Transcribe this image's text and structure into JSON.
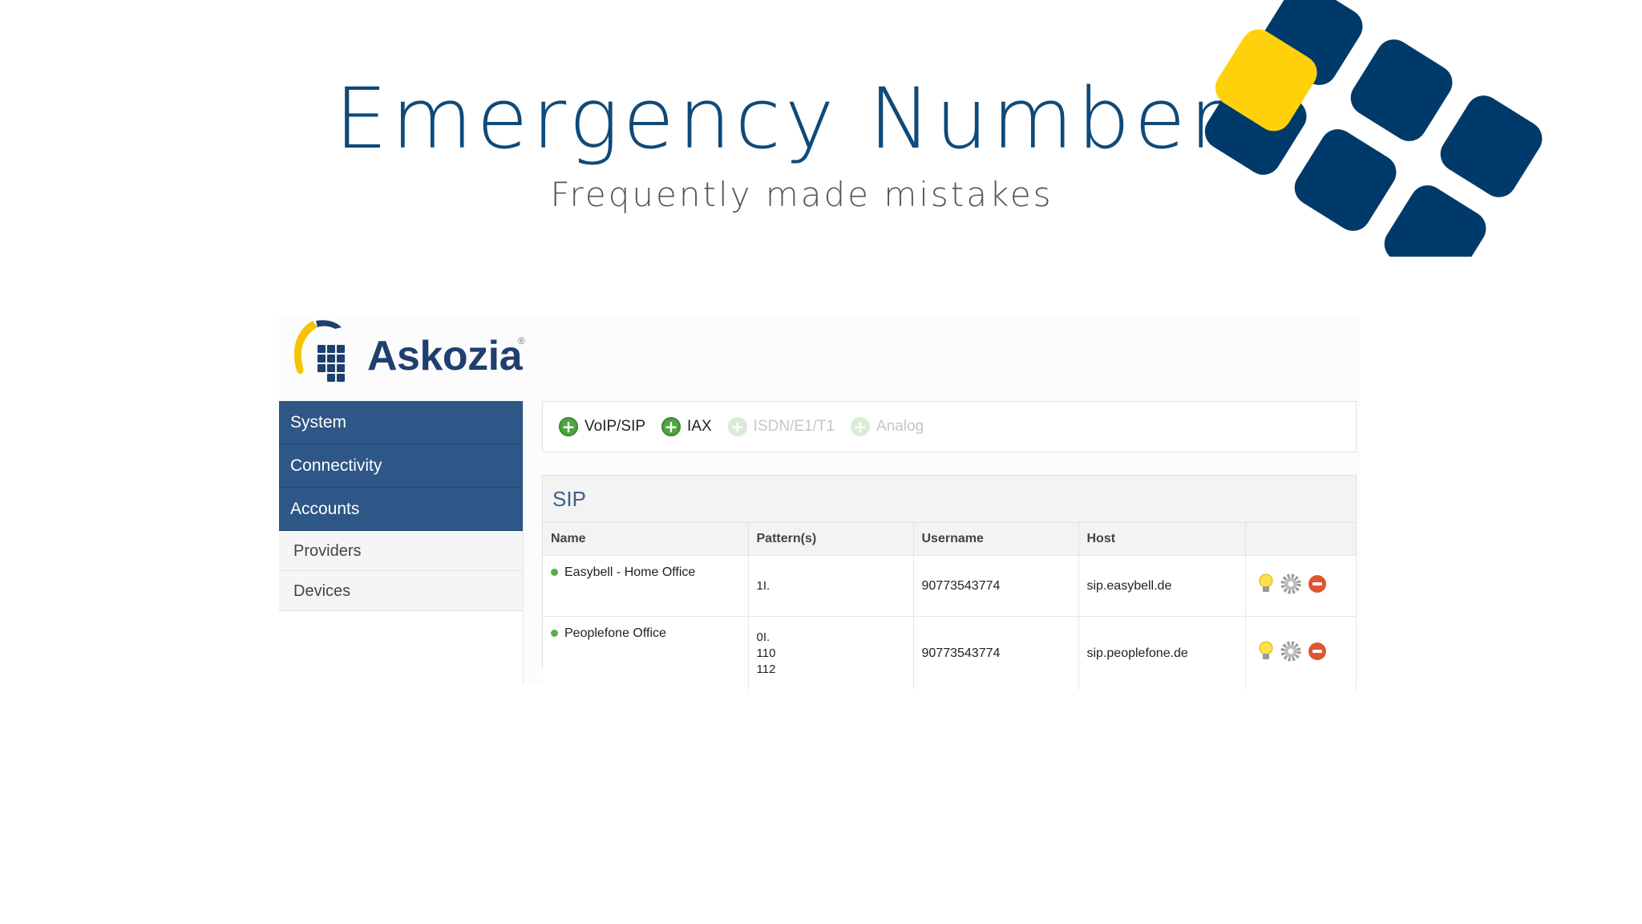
{
  "slide": {
    "title": "Emergency Numbers",
    "subtitle": "Frequently made mistakes"
  },
  "colors": {
    "title": "#0e4a7a",
    "deco_navy": "#003a6a",
    "deco_yellow": "#ffd10a",
    "sidebar_active": "#2e5686",
    "add_green": "#4fa540"
  },
  "logo": {
    "text": "Askozia"
  },
  "sidebar": {
    "main_items": [
      {
        "label": "System"
      },
      {
        "label": "Connectivity"
      },
      {
        "label": "Accounts"
      }
    ],
    "sub_items": [
      {
        "label": "Providers"
      },
      {
        "label": "Devices"
      }
    ]
  },
  "toolbar": {
    "items": [
      {
        "label": "VoIP/SIP",
        "enabled": true,
        "icon": "add-circle-icon"
      },
      {
        "label": "IAX",
        "enabled": true,
        "icon": "add-circle-icon"
      },
      {
        "label": "ISDN/E1/T1",
        "enabled": false,
        "icon": "add-circle-icon"
      },
      {
        "label": "Analog",
        "enabled": false,
        "icon": "add-circle-icon"
      }
    ]
  },
  "sip": {
    "title": "SIP",
    "columns": [
      "Name",
      "Pattern(s)",
      "Username",
      "Host",
      ""
    ],
    "rows": [
      {
        "name": "Easybell - Home Office",
        "patterns": [
          "1I."
        ],
        "username": "90773543774",
        "host": "sip.easybell.de",
        "actions": [
          "lightbulb-icon",
          "gear-icon",
          "delete-icon"
        ]
      },
      {
        "name": "Peoplefone Office",
        "patterns": [
          "0I.",
          "110",
          "112"
        ],
        "username": "90773543774",
        "host": "sip.peoplefone.de",
        "actions": [
          "lightbulb-icon",
          "gear-icon",
          "delete-icon"
        ]
      }
    ]
  }
}
